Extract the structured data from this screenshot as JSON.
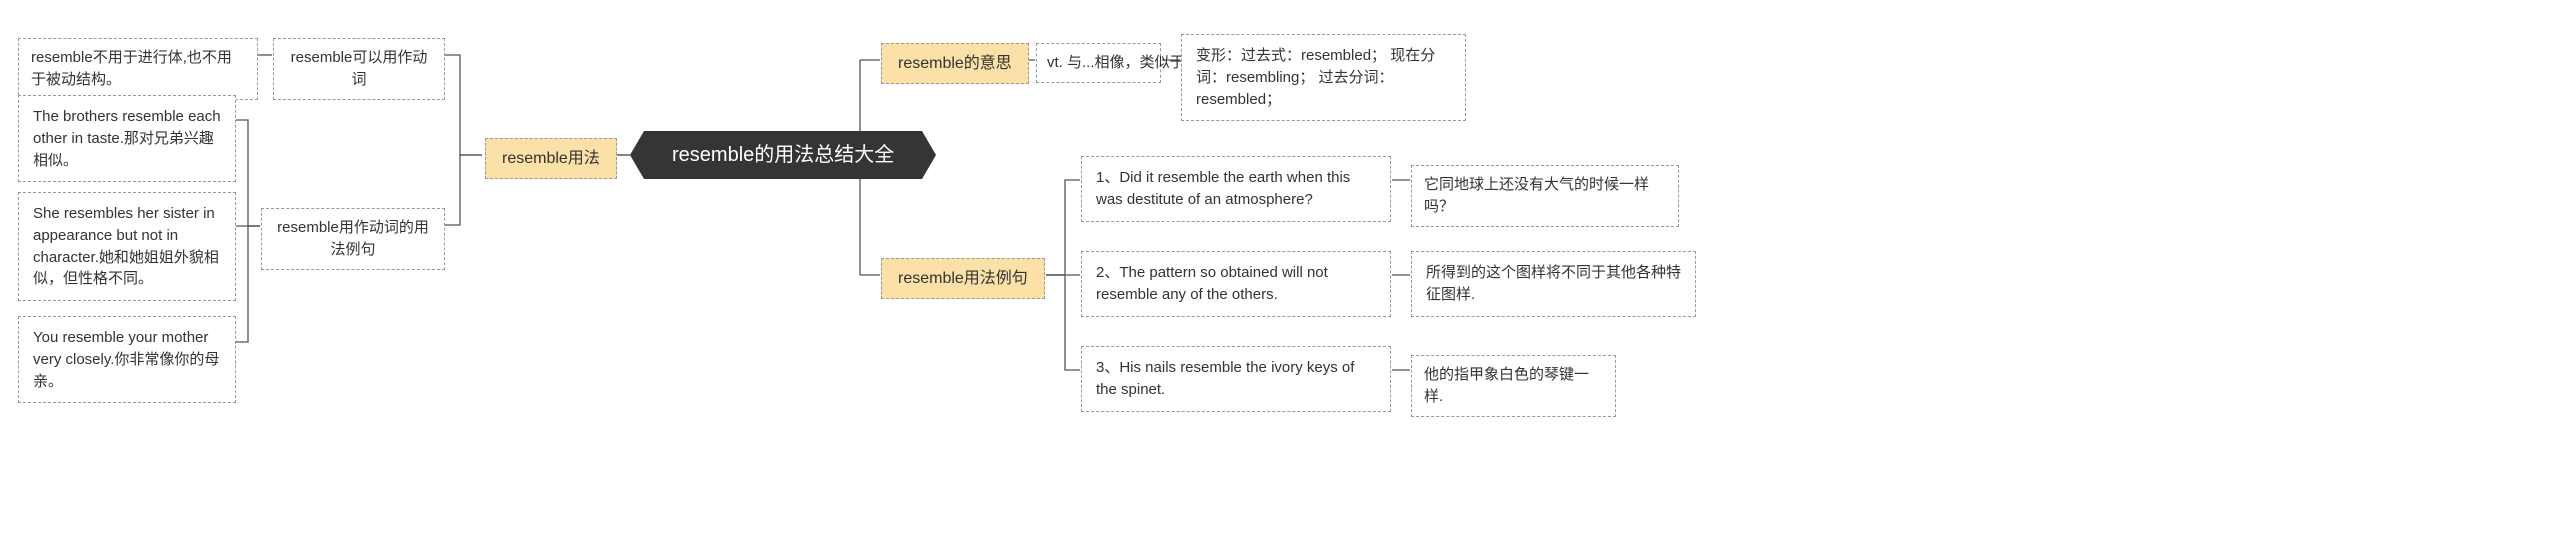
{
  "root": {
    "title": "resemble的用法总结大全"
  },
  "left": {
    "branch": "resemble用法",
    "sub1": {
      "label": "resemble可以用作动词",
      "detail": "resemble不用于进行体,也不用于被动结构。"
    },
    "sub2": {
      "label": "resemble用作动词的用法例句",
      "examples": [
        "The brothers resemble each other in taste.那对兄弟兴趣相似。",
        "She resembles her sister in appearance but not in character.她和她姐姐外貌相似，但性格不同。",
        "You resemble your mother very closely.你非常像你的母亲。"
      ]
    }
  },
  "right": {
    "meaningBranch": "resemble的意思",
    "meaning": {
      "def": "vt. 与...相像，类似于",
      "forms": "变形：过去式：resembled； 现在分词：resembling； 过去分词：resembled；"
    },
    "examplesBranch": "resemble用法例句",
    "examples": [
      {
        "en": "1、Did it resemble the earth when this was destitute of an atmosphere?",
        "zh": "它同地球上还没有大气的时候一样 吗？"
      },
      {
        "en": "2、The pattern so obtained will not resemble any of the others.",
        "zh": "所得到的这个图样将不同于其他各种特征图样."
      },
      {
        "en": "3、His nails resemble the ivory keys of the spinet.",
        "zh": "他的指甲象白色的琴键一样."
      }
    ]
  }
}
